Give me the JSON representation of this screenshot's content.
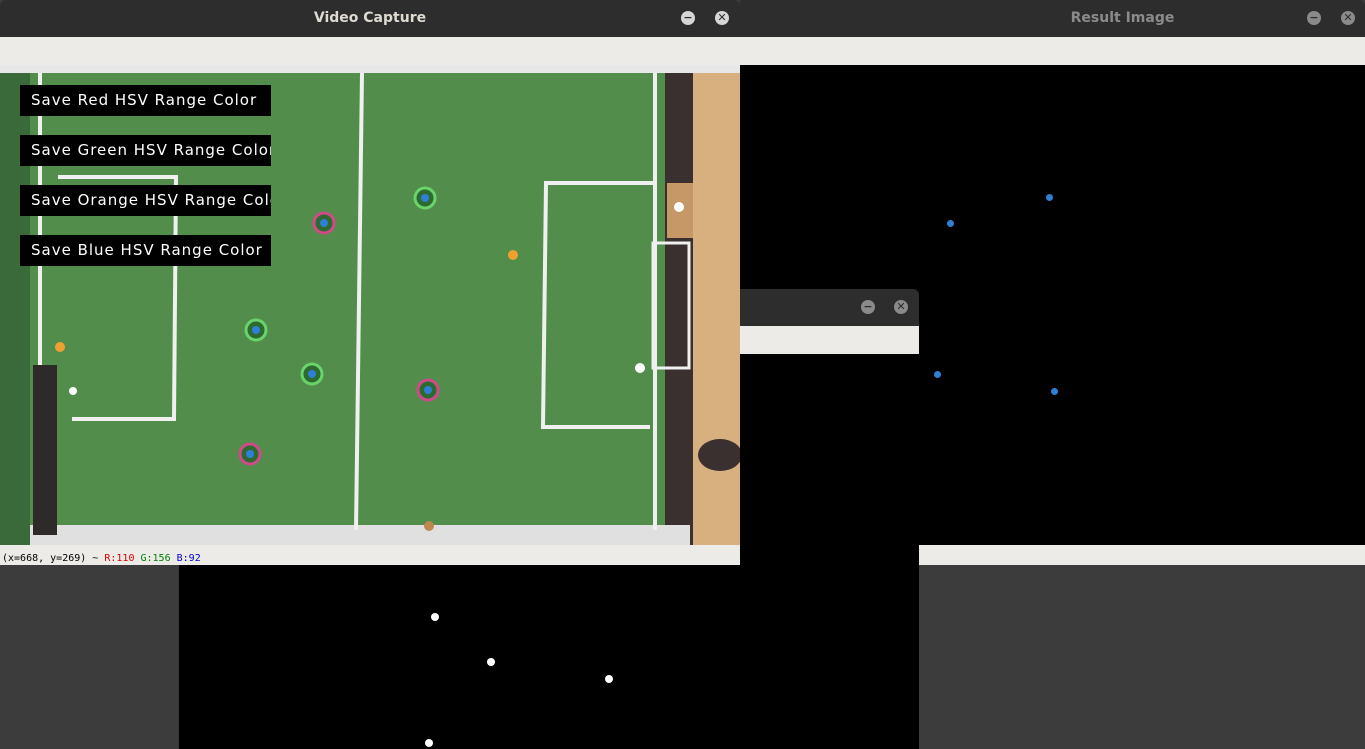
{
  "windows": {
    "video": {
      "title": "Video Capture"
    },
    "result": {
      "title": "Result Image"
    },
    "third": {
      "title": ""
    },
    "controls": {
      "minimize": "−",
      "close": "✕"
    }
  },
  "overlay_buttons": [
    "Save Red HSV Range Color",
    "Save Green HSV Range Color",
    "Save Orange HSV Range Color",
    "Save Blue HSV Range Color"
  ],
  "status": {
    "coords": "(x=668, y=269) ~",
    "r": "R:110",
    "g": "G:156",
    "b": "B:92",
    "r_color": "#d40000",
    "g_color": "#008000",
    "b_color": "#0000d4"
  },
  "colors": {
    "field_green": "#4f8a4a",
    "blue_blob": "#2f7fd6",
    "orange_ball": "#f0a030"
  }
}
